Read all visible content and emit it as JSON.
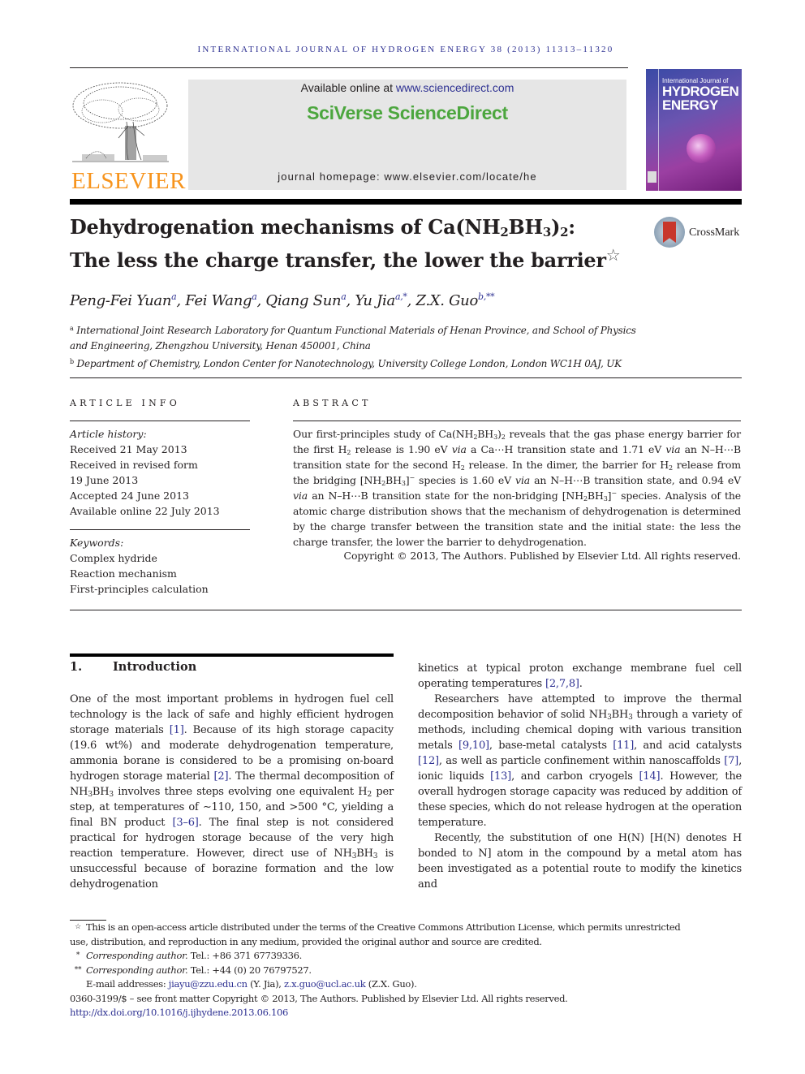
{
  "running_header": "INTERNATIONAL JOURNAL OF HYDROGEN ENERGY 38 (2013) 11313–11320",
  "publisher": {
    "logo_word": "ELSEVIER",
    "available_prefix": "Available online at ",
    "available_link": "www.sciencedirect.com",
    "platform_name": "SciVerse ScienceDirect",
    "homepage": "journal homepage: www.elsevier.com/locate/he",
    "colors": {
      "elsevier_orange": "#f7941d",
      "sciencedirect_green": "#4ca63e",
      "link_blue": "#2e3192"
    }
  },
  "cover": {
    "line1": "International Journal of",
    "line2": "HYDROGEN",
    "line3": "ENERGY"
  },
  "crossmark_label": "CrossMark",
  "title": {
    "line1_prefix": "Dehydrogenation mechanisms of Ca(NH",
    "sub1": "2",
    "mid1": "BH",
    "sub2": "3",
    "mid2": ")",
    "sub3": "2",
    "line1_suffix": ":",
    "line2": "The less the charge transfer, the lower the barrier",
    "star": "☆"
  },
  "authors": [
    {
      "name": "Peng-Fei Yuan",
      "marks": "a"
    },
    {
      "name": "Fei Wang",
      "marks": "a"
    },
    {
      "name": "Qiang Sun",
      "marks": "a"
    },
    {
      "name": "Yu Jia",
      "marks": "a,*"
    },
    {
      "name": "Z.X. Guo",
      "marks": "b,**"
    }
  ],
  "affiliations": [
    {
      "mark": "a",
      "line1": "International Joint Research Laboratory for Quantum Functional Materials of Henan Province, and School of Physics",
      "line2": "and Engineering, Zhengzhou University, Henan 450001, China"
    },
    {
      "mark": "b",
      "line1": "Department of Chemistry, London Center for Nanotechnology, University College London, London WC1H 0AJ, UK"
    }
  ],
  "article_info": {
    "heading": "ARTICLE INFO",
    "history_label": "Article history:",
    "history": [
      "Received 21 May 2013",
      "Received in revised form",
      "19 June 2013",
      "Accepted 24 June 2013",
      "Available online 22 July 2013"
    ],
    "keywords_label": "Keywords:",
    "keywords": [
      "Complex hydride",
      "Reaction mechanism",
      "First-principles calculation"
    ]
  },
  "abstract": {
    "heading": "ABSTRACT",
    "copyright": "Copyright © 2013, The Authors. Published by Elsevier Ltd. All rights reserved."
  },
  "section1": {
    "number": "1.",
    "title": "Introduction"
  },
  "footnotes": {
    "star_note_1": "This is an open-access article distributed under the terms of the Creative Commons Attribution License, which permits unrestricted",
    "star_note_2": "use, distribution, and reproduction in any medium, provided the original author and source are credited.",
    "corr1_label": "Corresponding author.",
    "corr1_tel": " Tel.: +86 371 67739336.",
    "corr2_label": "Corresponding author.",
    "corr2_tel": " Tel.: +44 (0) 20 76797527.",
    "email_prefix": "E-mail addresses: ",
    "email1": "jiayu@zzu.edu.cn",
    "email1_who": " (Y. Jia), ",
    "email2": "z.x.guo@ucl.ac.uk",
    "email2_who": " (Z.X. Guo).",
    "issn_line": "0360-3199/$ – see front matter Copyright © 2013, The Authors. Published by Elsevier Ltd. All rights reserved.",
    "doi": "http://dx.doi.org/10.1016/j.ijhydene.2013.06.106"
  }
}
